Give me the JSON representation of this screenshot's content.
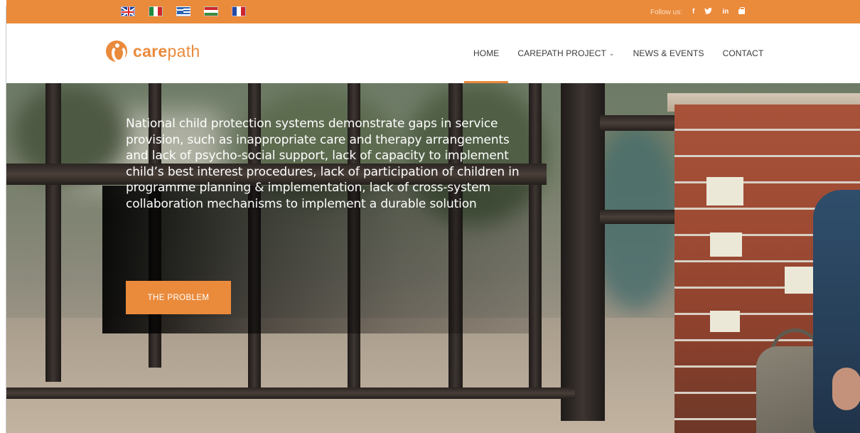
{
  "topbar": {
    "languages": [
      {
        "name": "English",
        "icon": "uk-flag-icon"
      },
      {
        "name": "Italian",
        "icon": "italy-flag-icon"
      },
      {
        "name": "Greek",
        "icon": "greece-flag-icon"
      },
      {
        "name": "Hungarian",
        "icon": "hungary-flag-icon"
      },
      {
        "name": "French",
        "icon": "france-flag-icon"
      }
    ],
    "follow_label": "Follow us:",
    "social": {
      "facebook": "f",
      "twitter_icon": "twitter-icon",
      "linkedin": "in",
      "youtube_icon": "youtube-icon"
    },
    "color": "#ea8a3b"
  },
  "header": {
    "logo_care": "care",
    "logo_path": "path",
    "nav": [
      {
        "label": "HOME",
        "active": true
      },
      {
        "label": "CAREPATH PROJECT",
        "has_dropdown": true
      },
      {
        "label": "NEWS & EVENTS"
      },
      {
        "label": "CONTACT"
      }
    ]
  },
  "hero": {
    "text": "National child protection systems demonstrate gaps in service provision, such as inappropriate care and therapy arrangements and lack of psycho-social support, lack of capacity to implement child’s best interest procedures, lack of participation of children in programme planning & implementation, lack of cross-system collaboration mechanisms to implement a durable solution",
    "cta_label": "THE PROBLEM"
  }
}
